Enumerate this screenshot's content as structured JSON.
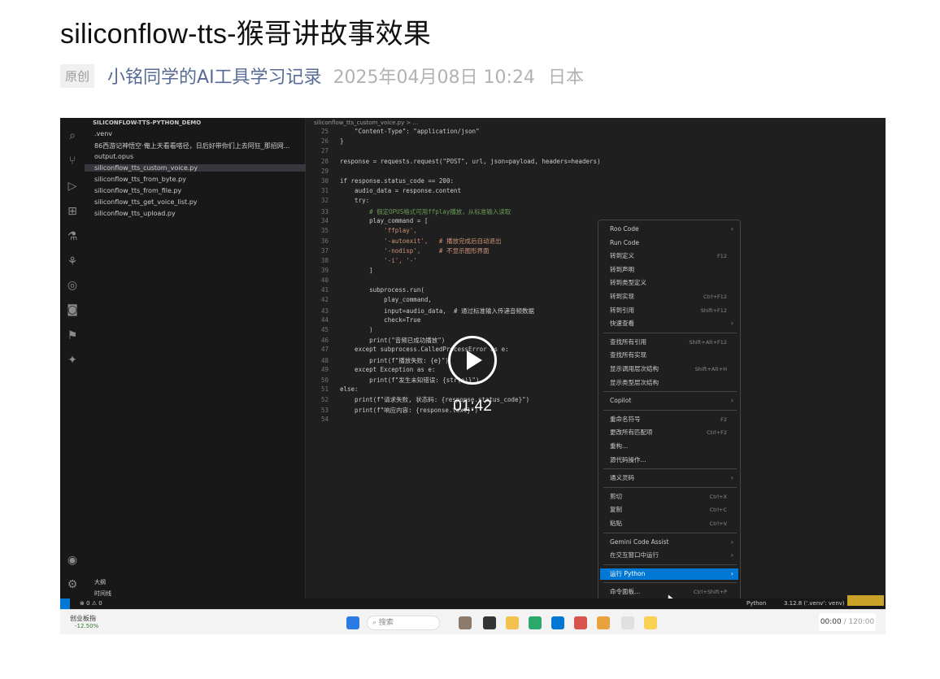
{
  "article": {
    "title": "siliconflow-tts-猴哥讲故事效果",
    "badge": "原创",
    "author": "小铭同学的AI工具学习记录",
    "date": "2025年04月08日 10:24",
    "location": "日本"
  },
  "video": {
    "duration_label": "01:42",
    "current_time": "00:00",
    "total_time": "/ 120:00",
    "explorer": {
      "header": "SILICONFLOW-TTS-PYTHON_DEMO",
      "files": [
        ".venv",
        "86西游记神悟空·俺上天看看嗒径，日后好带你们上去阿狂_那招网...",
        "output.opus",
        "siliconflow_tts_custom_voice.py",
        "siliconflow_tts_from_byte.py",
        "siliconflow_tts_from_file.py",
        "siliconflow_tts_get_voice_list.py",
        "siliconflow_tts_upload.py"
      ],
      "outline": "大纲",
      "timeline": "时间线"
    },
    "editor": {
      "breadcrumb": "siliconflow_tts_custom_voice.py > ...",
      "lines": [
        {
          "n": "25",
          "t": "    \"Content-Type\": \"application/json\""
        },
        {
          "n": "26",
          "t": "}"
        },
        {
          "n": "27",
          "t": ""
        },
        {
          "n": "28",
          "t": "response = requests.request(\"POST\", url, json=payload, headers=headers)"
        },
        {
          "n": "29",
          "t": ""
        },
        {
          "n": "30",
          "t": "if response.status_code == 200:"
        },
        {
          "n": "31",
          "t": "    audio_data = response.content"
        },
        {
          "n": "32",
          "t": "    try:"
        },
        {
          "n": "33",
          "t": "        # 假定OPUS格式可用ffplay播放，从标准输入读取"
        },
        {
          "n": "34",
          "t": "        play_command = ["
        },
        {
          "n": "35",
          "t": "            'ffplay',"
        },
        {
          "n": "36",
          "t": "            '-autoexit',   # 播放完成后自动退出"
        },
        {
          "n": "37",
          "t": "            '-nodisp',     # 不显示图形界面"
        },
        {
          "n": "38",
          "t": "            '-i', '-'"
        },
        {
          "n": "39",
          "t": "        ]"
        },
        {
          "n": "40",
          "t": ""
        },
        {
          "n": "41",
          "t": "        subprocess.run("
        },
        {
          "n": "42",
          "t": "            play_command,"
        },
        {
          "n": "43",
          "t": "            input=audio_data,  # 通过标准输入传递音频数据"
        },
        {
          "n": "44",
          "t": "            check=True"
        },
        {
          "n": "45",
          "t": "        )"
        },
        {
          "n": "46",
          "t": "        print(\"音频已成功播放\")"
        },
        {
          "n": "47",
          "t": "    except subprocess.CalledProcessError as e:"
        },
        {
          "n": "48",
          "t": "        print(f\"播放失败: {e}\")"
        },
        {
          "n": "49",
          "t": "    except Exception as e:"
        },
        {
          "n": "50",
          "t": "        print(f\"发生未知错误: {str(e)}\")"
        },
        {
          "n": "51",
          "t": "else:"
        },
        {
          "n": "52",
          "t": "    print(f\"请求失败, 状态码: {response.status_code}\")"
        },
        {
          "n": "53",
          "t": "    print(f\"响应内容: {response.text}\")"
        },
        {
          "n": "54",
          "t": ""
        }
      ]
    },
    "context_menu": [
      {
        "label": "Roo Code",
        "key": "",
        "sub": true
      },
      {
        "label": "Run Code",
        "key": "",
        "sub": false
      },
      {
        "label": "转到定义",
        "key": "F12",
        "sub": false
      },
      {
        "label": "转到声明",
        "key": "",
        "sub": false
      },
      {
        "label": "转到类型定义",
        "key": "",
        "sub": false
      },
      {
        "label": "转到实现",
        "key": "Ctrl+F12",
        "sub": false
      },
      {
        "label": "转到引用",
        "key": "Shift+F12",
        "sub": false
      },
      {
        "label": "快速查看",
        "key": "",
        "sub": true
      },
      {
        "label": "查找所有引用",
        "key": "Shift+Alt+F12",
        "sub": false
      },
      {
        "label": "查找所有实现",
        "key": "",
        "sub": false
      },
      {
        "label": "显示调用层次结构",
        "key": "Shift+Alt+H",
        "sub": false
      },
      {
        "label": "显示类型层次结构",
        "key": "",
        "sub": false
      },
      {
        "label": "Copilot",
        "key": "",
        "sub": true
      },
      {
        "label": "重命名符号",
        "key": "F2",
        "sub": false
      },
      {
        "label": "更改所有匹配项",
        "key": "Ctrl+F2",
        "sub": false
      },
      {
        "label": "重构...",
        "key": "",
        "sub": false
      },
      {
        "label": "源代码操作...",
        "key": "",
        "sub": false
      },
      {
        "label": "通义灵码",
        "key": "",
        "sub": true
      },
      {
        "label": "剪切",
        "key": "Ctrl+X",
        "sub": false
      },
      {
        "label": "复制",
        "key": "Ctrl+C",
        "sub": false
      },
      {
        "label": "粘贴",
        "key": "Ctrl+V",
        "sub": false
      },
      {
        "label": "Gemini Code Assist",
        "key": "",
        "sub": true
      },
      {
        "label": "在交互窗口中运行",
        "key": "",
        "sub": true
      },
      {
        "label": "运行 Python",
        "key": "",
        "sub": true
      },
      {
        "label": "命令面板...",
        "key": "Ctrl+Shift+P",
        "sub": false
      }
    ],
    "statusbar": {
      "left": "⊗ 0 ⚠ 0",
      "python": "Python",
      "version": "3.12.8 ('.venv': venv)"
    },
    "taskbar": {
      "stock_name": "创业板指",
      "stock_change": "-12.50%",
      "search_placeholder": "搜索"
    }
  }
}
